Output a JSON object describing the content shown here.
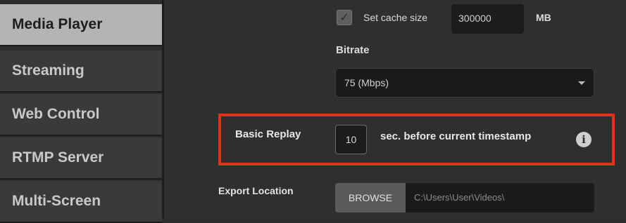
{
  "sidebar": {
    "items": [
      {
        "label": "Media Player",
        "active": true
      },
      {
        "label": "Streaming"
      },
      {
        "label": "Web Control"
      },
      {
        "label": "RTMP Server"
      },
      {
        "label": "Multi-Screen"
      }
    ]
  },
  "cache": {
    "checkbox_checked": true,
    "label": "Set cache size",
    "value": "300000",
    "unit": "MB"
  },
  "bitrate": {
    "label": "Bitrate",
    "selected": "75 (Mbps)"
  },
  "replay": {
    "label": "Basic Replay",
    "value": "10",
    "suffix": "sec. before current timestamp",
    "info_icon": "info-icon"
  },
  "export": {
    "label": "Export Location",
    "button": "BROWSE",
    "path": "C:\\Users\\User\\Videos\\"
  },
  "colors": {
    "highlight": "#e0321c",
    "active_tab": "#b4b4b4"
  }
}
